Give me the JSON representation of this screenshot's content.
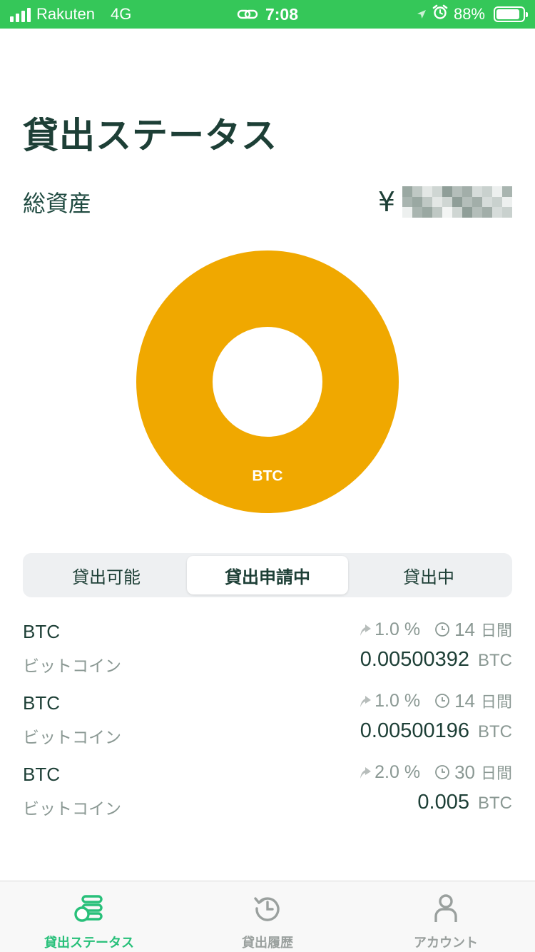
{
  "status_bar": {
    "carrier": "Rakuten",
    "network": "4G",
    "time": "7:08",
    "battery": "88%",
    "battery_level": 0.88
  },
  "page": {
    "title": "貸出ステータス",
    "total_label": "総資産",
    "currency_symbol": "¥"
  },
  "chart_data": {
    "type": "pie",
    "categories": [
      "BTC"
    ],
    "values": [
      100
    ],
    "colors": [
      "#f0a800"
    ]
  },
  "segmented": {
    "tabs": [
      {
        "label": "貸出可能",
        "active": false
      },
      {
        "label": "貸出申請中",
        "active": true
      },
      {
        "label": "貸出中",
        "active": false
      }
    ]
  },
  "lendings": [
    {
      "symbol": "BTC",
      "name": "ビットコイン",
      "rate": "1.0 %",
      "days": "14",
      "days_unit": "日間",
      "amount": "0.00500392",
      "unit": "BTC"
    },
    {
      "symbol": "BTC",
      "name": "ビットコイン",
      "rate": "1.0 %",
      "days": "14",
      "days_unit": "日間",
      "amount": "0.00500196",
      "unit": "BTC"
    },
    {
      "symbol": "BTC",
      "name": "ビットコイン",
      "rate": "2.0 %",
      "days": "30",
      "days_unit": "日間",
      "amount": "0.005",
      "unit": "BTC"
    }
  ],
  "tab_bar": {
    "items": [
      {
        "label": "貸出ステータス",
        "icon": "coins-stack-icon",
        "active": true
      },
      {
        "label": "貸出履歴",
        "icon": "history-icon",
        "active": false
      },
      {
        "label": "アカウント",
        "icon": "person-icon",
        "active": false
      }
    ]
  },
  "colors": {
    "accent": "#28c07a",
    "status_bar": "#35c759",
    "btc": "#f0a800",
    "text_dark": "#1d3f36",
    "text_muted": "#8a9893"
  }
}
